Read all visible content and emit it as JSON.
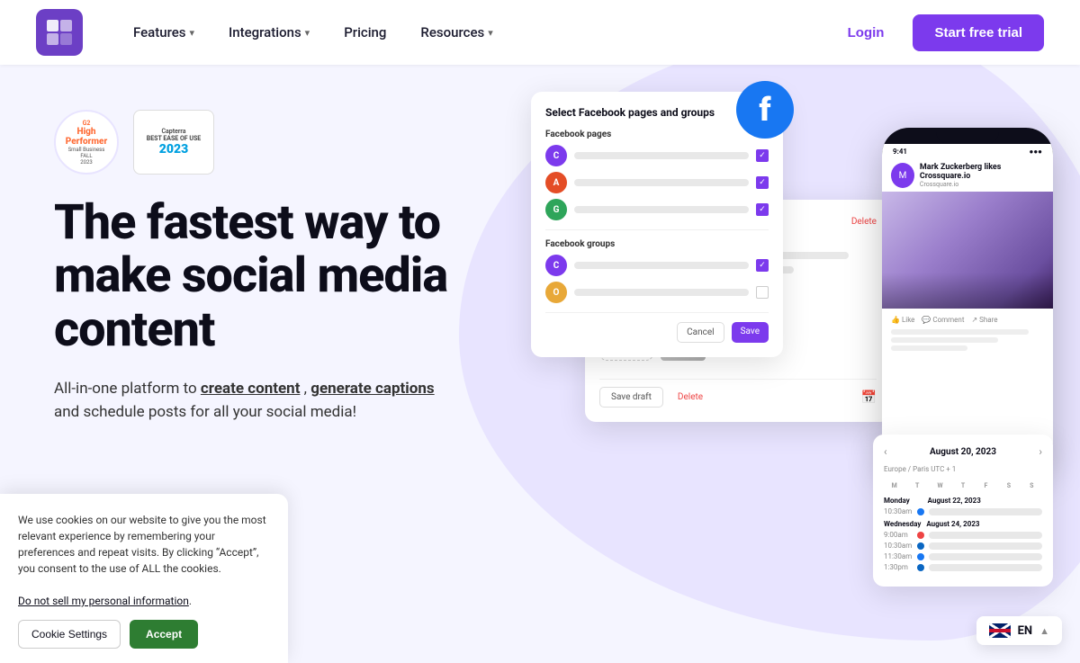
{
  "nav": {
    "logo_alt": "Crossquare logo",
    "features_label": "Features",
    "integrations_label": "Integrations",
    "pricing_label": "Pricing",
    "resources_label": "Resources",
    "login_label": "Login",
    "trial_label": "Start free trial"
  },
  "hero": {
    "badge_g2_top": "G2",
    "badge_g2_line1": "High",
    "badge_g2_line2": "Performer",
    "badge_g2_line3": "Small Business",
    "badge_g2_year": "FALL",
    "badge_g2_date": "2023",
    "badge_capterra_line1": "Capterra",
    "badge_capterra_line2": "BEST EASE OF USE",
    "badge_capterra_year": "2023",
    "title": "The fastest way to make social media content",
    "subtitle_start": "All-in-one platform to ",
    "subtitle_bold1": "create content",
    "subtitle_comma": ", ",
    "subtitle_bold2": "generate captions",
    "subtitle_end": " social media!",
    "subtitle_line2": "and schedule posts for all your"
  },
  "fb_card": {
    "title": "Select Facebook pages and groups",
    "pages_label": "Facebook pages",
    "groups_label": "Facebook groups",
    "cancel_label": "Cancel",
    "save_label": "Save",
    "avatar_colors": [
      "#7c3aed",
      "#e44d26",
      "#2ea55a"
    ],
    "avatar_labels": [
      "C",
      "A",
      "G"
    ],
    "group_avatar_colors": [
      "#7c3aed",
      "#e8a838"
    ],
    "group_avatar_labels": [
      "C",
      "O"
    ]
  },
  "calendar_card": {
    "title": "August 20, 2023",
    "timezone": "Europe / Paris UTC + 1",
    "days": [
      "M",
      "T",
      "W",
      "T",
      "F",
      "S",
      "S"
    ],
    "date1": "Monday",
    "date1_full": "August 22, 2023",
    "date2": "Wednesday",
    "date2_full": "August 24, 2023",
    "events": [
      {
        "time": "10:30am",
        "color": "#1877f2"
      },
      {
        "time": "9:00am",
        "color": "#e44"
      },
      {
        "time": "10:30am",
        "color": "#0a66c2"
      },
      {
        "time": "11:30am",
        "color": "#1877f2"
      },
      {
        "time": "1:30pm",
        "color": "#0a66c2"
      }
    ]
  },
  "cookie": {
    "text": "We use cookies on our website to give you the most relevant experience by remembering your preferences and repeat visits. By clicking “Accept”, you consent to the use of ALL the cookies.",
    "link_text": "Do not sell my personal information",
    "period": ".",
    "settings_label": "Cookie Settings",
    "accept_label": "Accept"
  },
  "language": {
    "code": "EN",
    "chevron": "▲"
  }
}
